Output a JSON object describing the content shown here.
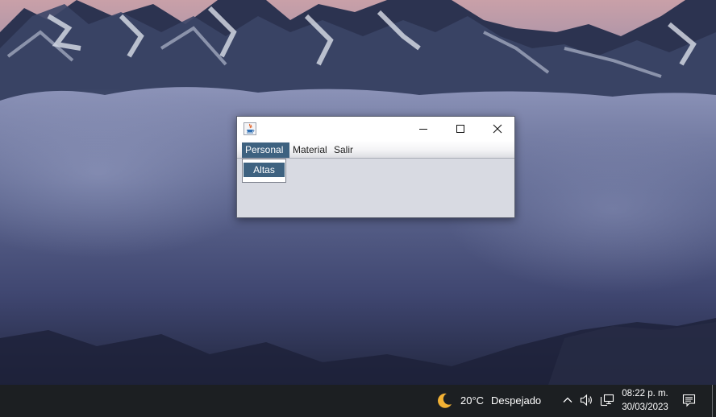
{
  "window": {
    "menus": [
      {
        "label": "Personal",
        "items": [
          "Altas"
        ]
      },
      {
        "label": "Material"
      },
      {
        "label": "Salir"
      }
    ]
  },
  "taskbar": {
    "weather_temp": "20°C",
    "weather_desc": "Despejado",
    "time": "08:22 p. m.",
    "date": "30/03/2023"
  },
  "icons": {
    "app": "java-icon",
    "minimize": "minimize-icon",
    "maximize": "maximize-icon",
    "close": "close-icon",
    "weather": "moon-icon",
    "tray_expand": "chevron-up-icon",
    "volume": "speaker-icon",
    "network": "network-icon",
    "notifications": "notification-icon"
  },
  "colors": {
    "menu_highlight": "#3e6280",
    "taskbar": "#1c1f22",
    "window_bg": "#d8dae2"
  }
}
